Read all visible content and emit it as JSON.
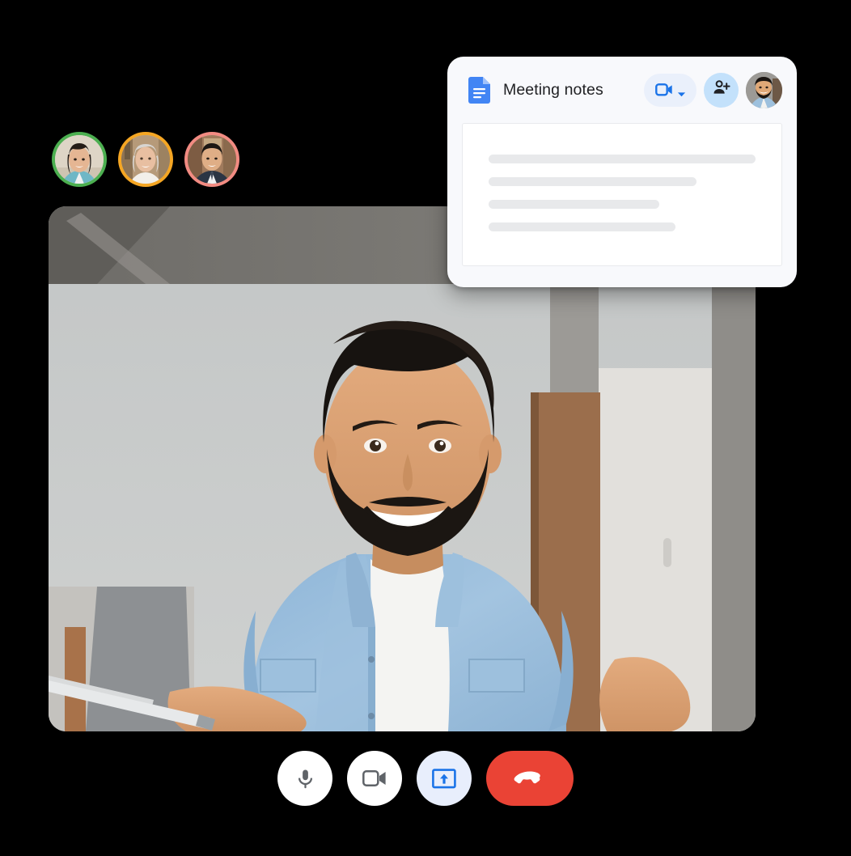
{
  "app": {
    "name": "Google Meet video call",
    "context": "video meeting with companion document panel"
  },
  "participants": {
    "label": "Meeting participants",
    "avatars": [
      {
        "name": "participant-1",
        "ring_color": "#4CAF50",
        "ring_name": "green"
      },
      {
        "name": "participant-2",
        "ring_color": "#F5A623",
        "ring_name": "amber"
      },
      {
        "name": "participant-3",
        "ring_color": "#F28B82",
        "ring_name": "salmon"
      }
    ]
  },
  "video": {
    "label": "Main speaker video tile",
    "subject": "smiling man in light denim shirt over white t-shirt",
    "background": "modern office room with concrete ceiling and wooden door",
    "corner_radius_px": 22
  },
  "notes_card": {
    "doc_icon": "google-docs-icon",
    "title": "Meeting notes",
    "camera_button": {
      "icon": "video-camera-icon",
      "dropdown_icon": "chevron-down-icon",
      "background": "#EAF0FB",
      "icon_color": "#1A73E8"
    },
    "add_person_button": {
      "icon": "person-add-icon",
      "background": "#C3E1FB",
      "icon_color": "#202124"
    },
    "header_avatar": {
      "icon": "avatar",
      "subject": "same man as in the main video tile"
    },
    "body_lines": [
      {
        "width_pct": 100
      },
      {
        "width_pct": 78
      },
      {
        "width_pct": 64
      },
      {
        "width_pct": 70
      }
    ],
    "body_line_color": "#E8E9EB"
  },
  "controls": {
    "label": "Meeting control bar",
    "buttons": [
      {
        "name": "microphone-button",
        "icon": "microphone-icon",
        "background": "#FFFFFF",
        "icon_color": "#5F6368",
        "shape": "circle"
      },
      {
        "name": "camera-button",
        "icon": "video-camera-icon",
        "background": "#FFFFFF",
        "icon_color": "#5F6368",
        "shape": "circle"
      },
      {
        "name": "present-screen-button",
        "icon": "present-screen-icon",
        "background": "#E8EEFC",
        "icon_color": "#1A73E8",
        "shape": "circle"
      },
      {
        "name": "end-call-button",
        "icon": "phone-hangup-icon",
        "background": "#EA4335",
        "icon_color": "#FFFFFF",
        "shape": "pill"
      }
    ]
  },
  "colors": {
    "page_background": "#000000",
    "card_background": "#F8F9FC",
    "doc_page_background": "#FFFFFF",
    "brand_blue": "#1A73E8",
    "docs_blue": "#4285F4",
    "danger_red": "#EA4335",
    "text_primary": "#202124",
    "icon_gray": "#5F6368"
  }
}
